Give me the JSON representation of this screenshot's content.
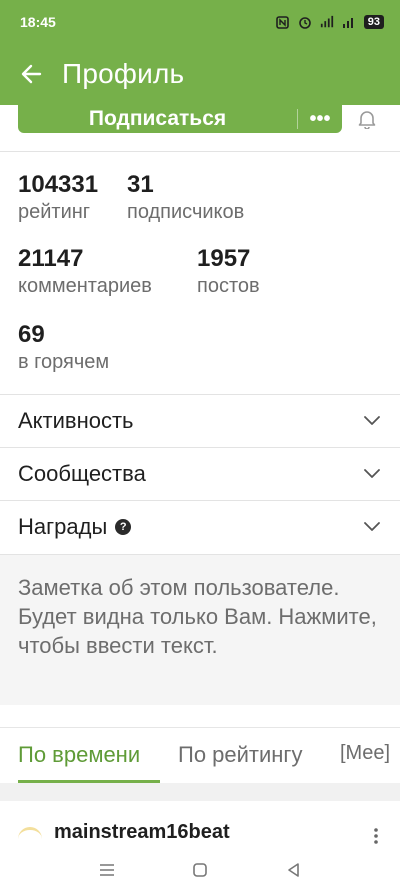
{
  "status_bar": {
    "time": "18:45",
    "battery": "93"
  },
  "header": {
    "title": "Профиль"
  },
  "actions": {
    "subscribe_label": "Подписаться",
    "more_label": "•••"
  },
  "stats": [
    {
      "value": "104331",
      "label": "рейтинг"
    },
    {
      "value": "31",
      "label": "подписчиков"
    },
    {
      "value": "21147",
      "label": "комментариев"
    },
    {
      "value": "1957",
      "label": "постов"
    },
    {
      "value": "69",
      "label": "в горячем"
    }
  ],
  "sections": [
    {
      "label": "Активность"
    },
    {
      "label": "Сообщества"
    },
    {
      "label": "Награды",
      "help": "?"
    }
  ],
  "note": {
    "text": "Заметка об этом пользователе. Будет видна только Вам. Нажмите, чтобы ввести текст."
  },
  "tabs": [
    {
      "label": "По времени",
      "active": true
    },
    {
      "label": "По рейтингу",
      "active": false
    }
  ],
  "tabs_more": "[Mee]",
  "post": {
    "author": "mainstream16beat"
  },
  "colors": {
    "accent": "#76b04a",
    "accent_text": "#5f9b37",
    "secondary_text": "#6d6d6d"
  },
  "icons": [
    "back-arrow-icon",
    "bell-icon",
    "chevron-down-icon",
    "help-icon",
    "more-vert-icon",
    "nav-menu-icon",
    "nav-home-icon",
    "nav-back-icon"
  ]
}
